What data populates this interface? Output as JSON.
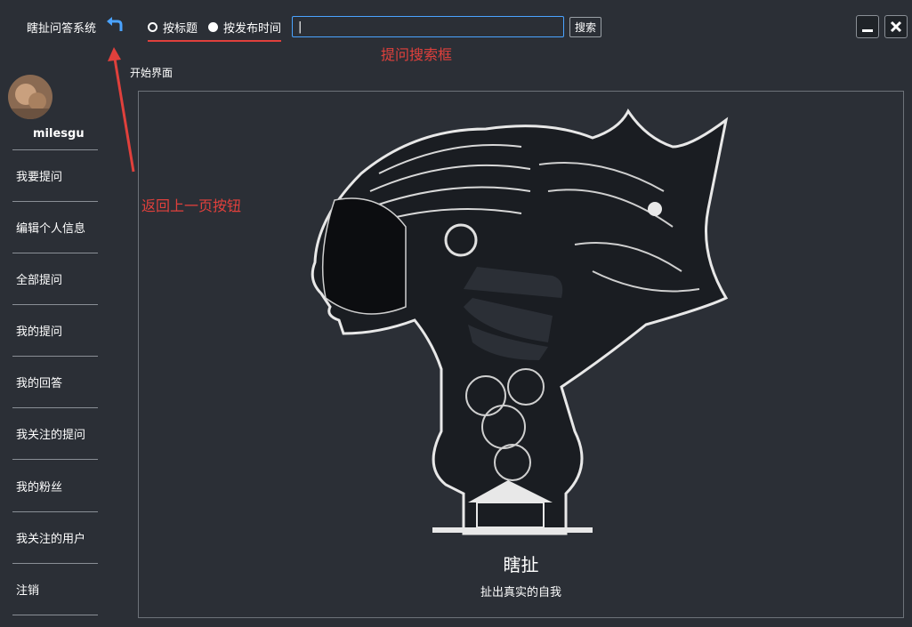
{
  "app": {
    "title": "瞎扯问答系统"
  },
  "search": {
    "mode_options": [
      {
        "label": "按标题",
        "selected": false
      },
      {
        "label": "按发布时间",
        "selected": true
      }
    ],
    "input_value": "|",
    "button_label": "搜索"
  },
  "annotations": {
    "search_box_note": "提问搜索框",
    "back_button_note": "返回上一页按钮"
  },
  "breadcrumb": "开始界面",
  "user": {
    "name": "milesgu"
  },
  "sidebar": {
    "items": [
      {
        "label": "我要提问"
      },
      {
        "label": "编辑个人信息"
      },
      {
        "label": "全部提问"
      },
      {
        "label": "我的提问"
      },
      {
        "label": "我的回答"
      },
      {
        "label": "我关注的提问"
      },
      {
        "label": "我的粉丝"
      },
      {
        "label": "我关注的用户"
      },
      {
        "label": "注销"
      }
    ]
  },
  "hero": {
    "title": "瞎扯",
    "subtitle": "扯出真实的自我"
  },
  "colors": {
    "background": "#2b2f36",
    "accent_annotation": "#e0403c",
    "input_focus": "#4aa3ff",
    "back_icon": "#4aa3ff"
  },
  "icons": {
    "back": "undo-arrow-icon",
    "minimize": "minimize-icon",
    "close": "close-icon"
  }
}
